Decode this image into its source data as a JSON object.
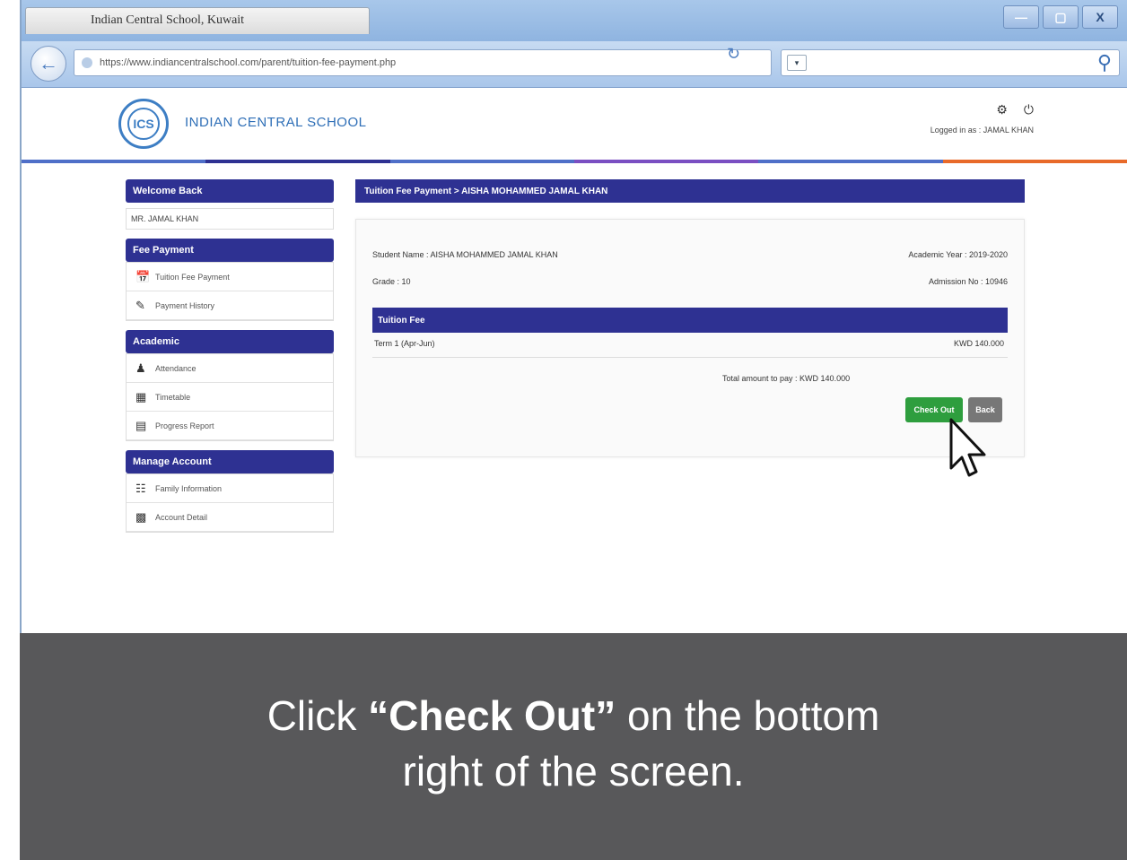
{
  "browser": {
    "tab_title": "Indian Central School, Kuwait",
    "address": "https://www.indiancentralschool.com/parent/tuition-fee-payment.php",
    "search_dropdown": "▾",
    "window_buttons": {
      "minimize": "—",
      "restore": "▢",
      "close": "X"
    }
  },
  "site": {
    "school_name": "INDIAN CENTRAL SCHOOL",
    "logo_text": "ICS",
    "logged_in": "Logged in as : JAMAL KHAN",
    "stripe_colors": [
      "#4f6fc8",
      "#2e3192",
      "#4f6fc8",
      "#7a4fc2",
      "#4f6fc8",
      "#e86a2a"
    ]
  },
  "sidebar": {
    "welcome": {
      "title": "Welcome Back",
      "user": "MR. JAMAL KHAN"
    },
    "fee_payment": {
      "title": "Fee Payment",
      "items": [
        {
          "icon": "calendar-icon",
          "label": "Tuition Fee Payment"
        },
        {
          "icon": "history-icon",
          "label": "Payment History"
        }
      ]
    },
    "academic": {
      "title": "Academic",
      "items": [
        {
          "icon": "attendance-icon",
          "label": "Attendance"
        },
        {
          "icon": "timetable-icon",
          "label": "Timetable"
        },
        {
          "icon": "progress-report-icon",
          "label": "Progress Report"
        }
      ]
    },
    "account": {
      "title": "Manage Account",
      "items": [
        {
          "icon": "family-info-icon",
          "label": "Family Information"
        },
        {
          "icon": "account-detail-icon",
          "label": "Account Detail"
        }
      ]
    }
  },
  "main": {
    "header": "Tuition Fee Payment > AISHA MOHAMMED JAMAL KHAN",
    "student_line": "Student Name : AISHA MOHAMMED JAMAL KHAN",
    "academic_year": "Academic Year : 2019-2020",
    "grade": "Grade : 10",
    "admission_no": "Admission No : 10946",
    "fee_title": "Tuition Fee",
    "fee_row_label": "Term 1 (Apr-Jun)",
    "fee_row_value": "KWD 140.000",
    "total": "Total amount to pay : KWD 140.000",
    "checkout_label": "Check Out",
    "back_label": "Back"
  },
  "caption": {
    "prefix": "Click ",
    "emphasis": "“Check Out”",
    "suffix": " on the bottom",
    "line2": "right of the screen."
  }
}
